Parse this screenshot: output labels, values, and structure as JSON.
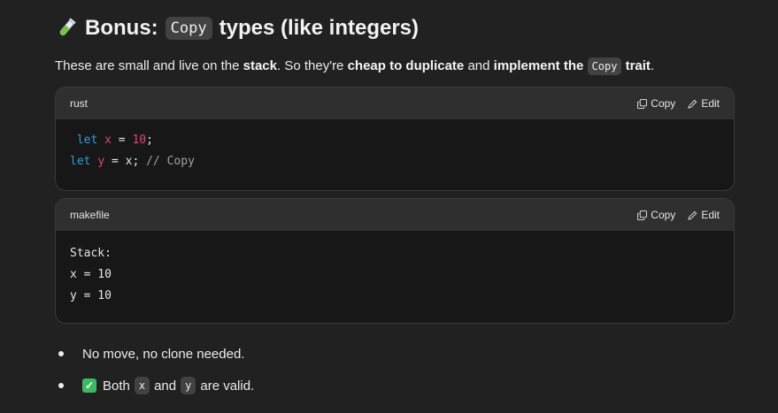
{
  "heading": {
    "icon": "test-tube-icon",
    "prefix": "Bonus:",
    "code": "Copy",
    "suffix": "types (like integers)"
  },
  "intro": {
    "part1": "These are small and live on the ",
    "bold1": "stack",
    "part2": ". So they're ",
    "bold2": "cheap to duplicate",
    "part3": " and ",
    "bold3": "implement the",
    "code": "Copy",
    "bold4": "trait",
    "part4": "."
  },
  "code_blocks": [
    {
      "language": "rust",
      "copy_label": "Copy",
      "edit_label": "Edit",
      "lines": [
        {
          "kw": "let",
          "var": "x",
          "op": " = ",
          "num": "10",
          "end": ";",
          "comment": ""
        },
        {
          "kw": "let",
          "var": "y",
          "op": " = ",
          "num": "",
          "end": "x; ",
          "comment": "// Copy"
        }
      ]
    },
    {
      "language": "makefile",
      "copy_label": "Copy",
      "edit_label": "Edit",
      "lines": [
        "Stack:",
        "x = 10",
        "y = 10"
      ]
    }
  ],
  "bullets": [
    {
      "text": "No move, no clone needed."
    },
    {
      "icon": "check-mark-icon",
      "pre": "Both",
      "code1": "x",
      "mid": "and",
      "code2": "y",
      "post": "are valid."
    }
  ],
  "colors": {
    "background": "#212121",
    "code_header": "#2f2f2f",
    "code_body": "#171717",
    "keyword": "#2f9ed8",
    "identifier": "#e0457b",
    "check": "#3dbb62"
  }
}
